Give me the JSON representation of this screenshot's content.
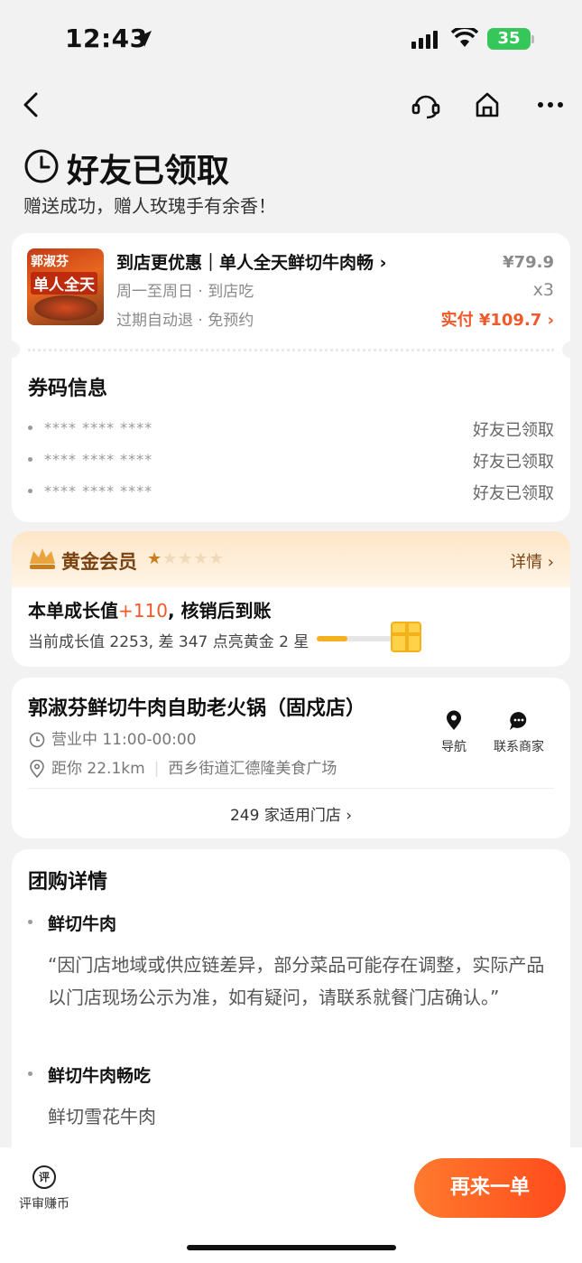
{
  "status": {
    "time": "12:43",
    "battery": "35"
  },
  "header": {
    "title": "好友已领取",
    "subtitle": "赠送成功，赠人玫瑰手有余香！"
  },
  "product": {
    "image_brand": "郭淑芬",
    "image_badge": "单人全天",
    "name": "到店更优惠｜单人全天鲜切牛肉畅 ›",
    "schedule": "周一至周日 · 到店吃",
    "policy": "过期自动退 · 免预约",
    "price": "¥79.9",
    "quantity": "x3",
    "paid": "实付 ¥109.7 ›"
  },
  "vouchers": {
    "title": "券码信息",
    "items": [
      {
        "code": "**** **** ****",
        "status": "好友已领取"
      },
      {
        "code": "**** **** ****",
        "status": "好友已领取"
      },
      {
        "code": "**** **** ****",
        "status": "好友已领取"
      }
    ]
  },
  "member": {
    "level": "黄金会员",
    "stars_filled": 1,
    "stars_total": 5,
    "details": "详情 ›",
    "growth_prefix": "本单成长值",
    "growth_value": "+110",
    "growth_suffix": ", 核销后到账",
    "current_text": "当前成长值 2253, 差 347 点亮黄金 2 星",
    "progress": 0.4,
    "colors": {
      "accent": "#f0592a",
      "gold": "#f5b020"
    }
  },
  "store": {
    "name": "郭淑芬鲜切牛肉自助老火锅（固戍店）",
    "hours": "营业中 11:00-00:00",
    "distance": "距你 22.1km",
    "address": "西乡街道汇德隆美食广场",
    "nav_label": "导航",
    "contact_label": "联系商家",
    "count": "249 家适用门店 ›"
  },
  "group_detail": {
    "title": "团购详情",
    "items": [
      {
        "name": "鲜切牛肉",
        "desc": "“因门店地域或供应链差异，部分菜品可能存在调整，实际产品以门店现场公示为准，如有疑问，请联系就餐门店确认。”"
      },
      {
        "name": "鲜切牛肉畅吃",
        "desc": "鲜切雪花牛肉"
      }
    ]
  },
  "bottom": {
    "review_label": "评审赚币",
    "review_icon": "评",
    "again_label": "再来一单"
  }
}
